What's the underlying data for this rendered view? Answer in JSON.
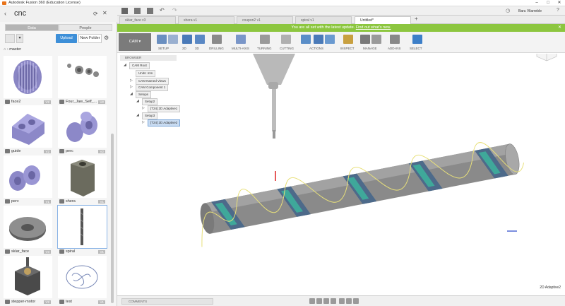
{
  "window": {
    "title": "Autodesk Fusion 360 (Education License)",
    "controls": [
      "–",
      "□",
      "✕"
    ]
  },
  "data_panel": {
    "title": "cnc",
    "tabs": [
      {
        "label": "Data",
        "active": true
      },
      {
        "label": "People",
        "active": false
      }
    ],
    "upload_label": "Upload",
    "new_folder_label": "New Folder",
    "breadcrumb": "master",
    "items": [
      {
        "name": "face2",
        "version": "V2"
      },
      {
        "name": "Four_Jaw_Self_...",
        "version": "V2"
      },
      {
        "name": "guide",
        "version": "V2"
      },
      {
        "name": "perc",
        "version": "V2"
      },
      {
        "name": "perc",
        "version": "V1"
      },
      {
        "name": "shera",
        "version": "V1"
      },
      {
        "name": "sklar_face",
        "version": "V3"
      },
      {
        "name": "spiral",
        "version": "V1"
      },
      {
        "name": "stepper-motor",
        "version": "V2"
      },
      {
        "name": "test",
        "version": "V1"
      }
    ]
  },
  "doc_tabs": [
    {
      "label": "sklar_face v3",
      "active": false
    },
    {
      "label": "shera v1",
      "active": false
    },
    {
      "label": "coupon2 v1",
      "active": false
    },
    {
      "label": "spiral v1",
      "active": false
    },
    {
      "label": "Untitled*",
      "active": true
    }
  ],
  "user_name": "Baru Vilarreble",
  "banner": {
    "message": "You are all set with the latest update.",
    "link": "Find out what's new."
  },
  "ribbon": {
    "workspace": "CAM",
    "groups": [
      "SETUP",
      "2D",
      "3D",
      "DRILLING",
      "MULTI-AXIS",
      "TURNING",
      "CUTTING",
      "ACTIONS",
      "INSPECT",
      "MANAGE",
      "ADD-INS",
      "SELECT"
    ]
  },
  "browser": {
    "header": "BROWSER",
    "nodes": [
      {
        "label": "CAM Root",
        "depth": 0
      },
      {
        "label": "Units: mm",
        "depth": 1
      },
      {
        "label": "CAM Named Views",
        "depth": 1
      },
      {
        "label": "CAM Component 1",
        "depth": 1
      },
      {
        "label": "Setups",
        "depth": 1
      },
      {
        "label": "Setup2",
        "depth": 2
      },
      {
        "label": "[T24] 2D Adaptive1",
        "depth": 3
      },
      {
        "label": "Setup3",
        "depth": 2
      },
      {
        "label": "[T24] 2D Adaptive2",
        "depth": 3
      }
    ]
  },
  "bottom": {
    "comments_label": "COMMENTS",
    "status": "2D Adaptive2"
  },
  "colors": {
    "banner": "#8cc63f",
    "upload": "#3d8fd8",
    "selection": "#c9dcf2",
    "toolpath": "#e8e07a"
  }
}
